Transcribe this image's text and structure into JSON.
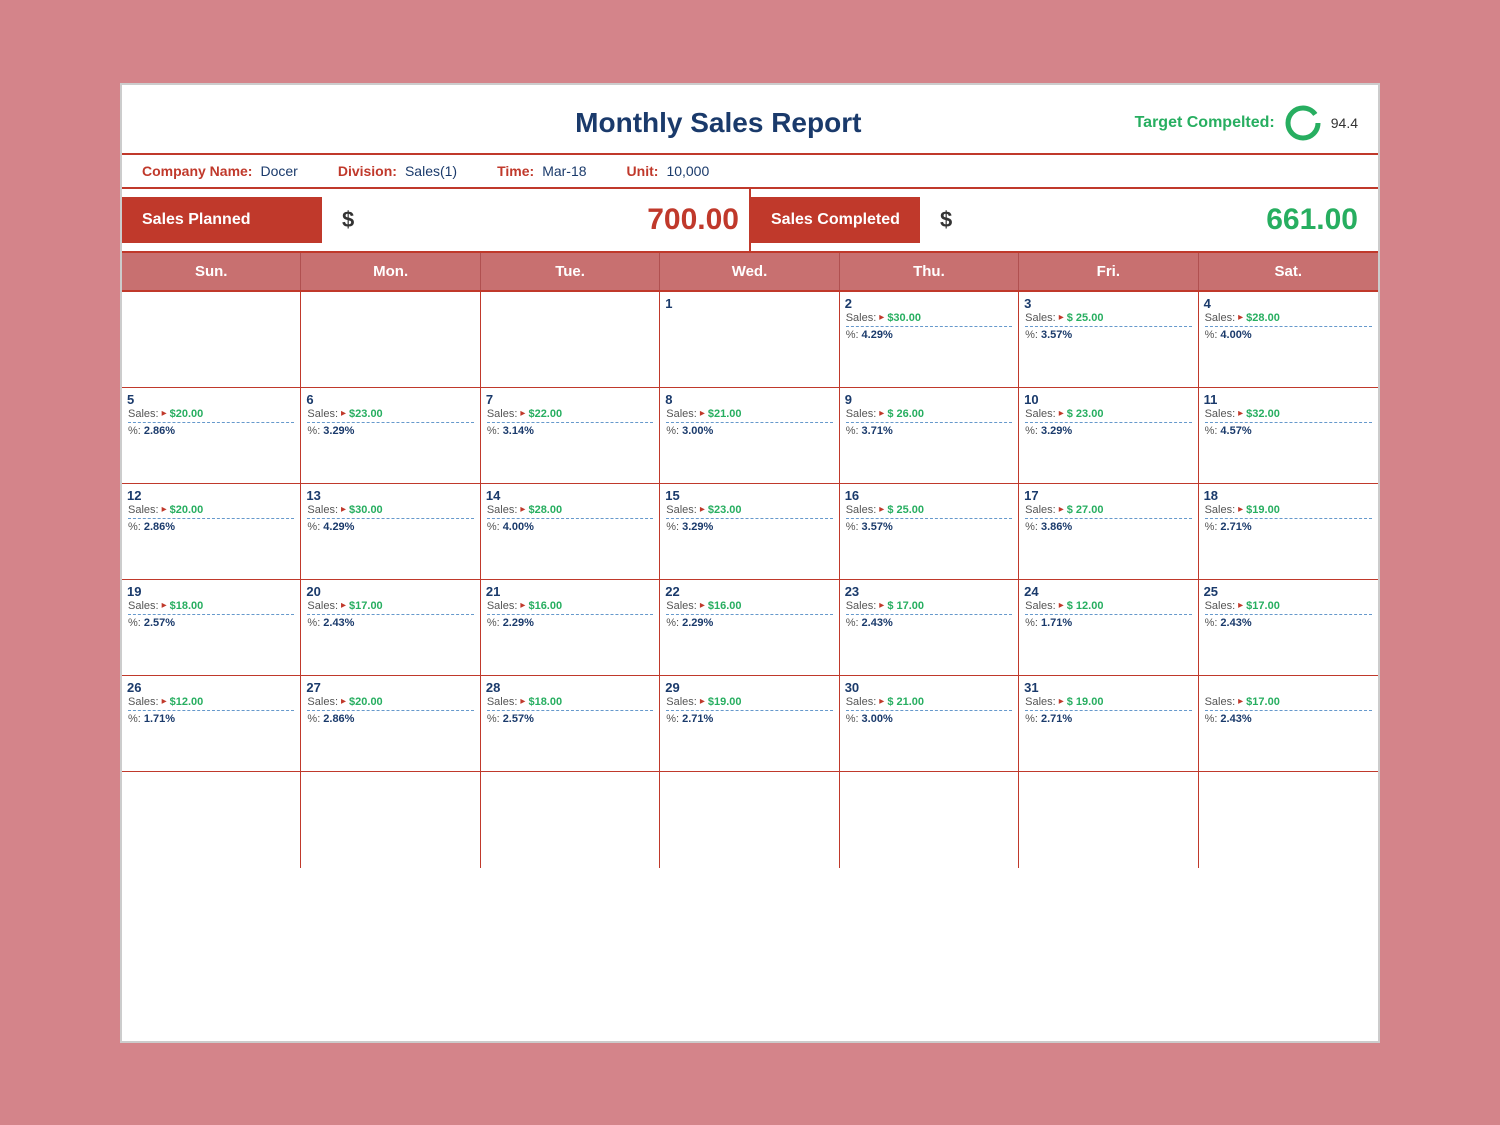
{
  "report": {
    "title": "Monthly Sales Report",
    "target_label": "Target Compelted:",
    "target_value": "94.4",
    "company_label": "Company Name:",
    "company_name": "Docer",
    "division_label": "Division:",
    "division_value": "Sales(1)",
    "time_label": "Time:",
    "time_value": "Mar-18",
    "unit_label": "Unit:",
    "unit_value": "10,000",
    "sales_planned_label": "Sales Planned",
    "sales_planned_dollar": "$",
    "sales_planned_amount": "700.00",
    "sales_completed_label": "Sales Completed",
    "sales_completed_dollar": "$",
    "sales_completed_amount": "661.00"
  },
  "day_headers": [
    "Sun.",
    "Mon.",
    "Tue.",
    "Wed.",
    "Thu.",
    "Fri.",
    "Sat."
  ],
  "weeks": [
    [
      {
        "day": "",
        "sales": "",
        "pct": ""
      },
      {
        "day": "",
        "sales": "",
        "pct": ""
      },
      {
        "day": "",
        "sales": "",
        "pct": ""
      },
      {
        "day": "1",
        "sales": "",
        "pct": ""
      },
      {
        "day": "2",
        "sales": "$30.00",
        "pct": "4.29%"
      },
      {
        "day": "3",
        "sales": "$ 25.00",
        "pct": "3.57%"
      },
      {
        "day": "4",
        "sales": "$28.00",
        "pct": "4.00%"
      }
    ],
    [
      {
        "day": "5",
        "sales": "$20.00",
        "pct": "2.86%"
      },
      {
        "day": "6",
        "sales": "$23.00",
        "pct": "3.29%"
      },
      {
        "day": "7",
        "sales": "$22.00",
        "pct": "3.14%"
      },
      {
        "day": "8",
        "sales": "$21.00",
        "pct": "3.00%"
      },
      {
        "day": "9",
        "sales": "$ 26.00",
        "pct": "3.71%"
      },
      {
        "day": "10",
        "sales": "$ 23.00",
        "pct": "3.29%"
      },
      {
        "day": "11",
        "sales": "$32.00",
        "pct": "4.57%"
      }
    ],
    [
      {
        "day": "12",
        "sales": "$20.00",
        "pct": "2.86%"
      },
      {
        "day": "13",
        "sales": "$30.00",
        "pct": "4.29%"
      },
      {
        "day": "14",
        "sales": "$28.00",
        "pct": "4.00%"
      },
      {
        "day": "15",
        "sales": "$23.00",
        "pct": "3.29%"
      },
      {
        "day": "16",
        "sales": "$ 25.00",
        "pct": "3.57%"
      },
      {
        "day": "17",
        "sales": "$ 27.00",
        "pct": "3.86%"
      },
      {
        "day": "18",
        "sales": "$19.00",
        "pct": "2.71%"
      }
    ],
    [
      {
        "day": "19",
        "sales": "$18.00",
        "pct": "2.57%"
      },
      {
        "day": "20",
        "sales": "$17.00",
        "pct": "2.43%"
      },
      {
        "day": "21",
        "sales": "$16.00",
        "pct": "2.29%"
      },
      {
        "day": "22",
        "sales": "$16.00",
        "pct": "2.29%"
      },
      {
        "day": "23",
        "sales": "$ 17.00",
        "pct": "2.43%"
      },
      {
        "day": "24",
        "sales": "$ 12.00",
        "pct": "1.71%"
      },
      {
        "day": "25",
        "sales": "$17.00",
        "pct": "2.43%"
      }
    ],
    [
      {
        "day": "26",
        "sales": "$12.00",
        "pct": "1.71%"
      },
      {
        "day": "27",
        "sales": "$20.00",
        "pct": "2.86%"
      },
      {
        "day": "28",
        "sales": "$18.00",
        "pct": "2.57%"
      },
      {
        "day": "29",
        "sales": "$19.00",
        "pct": "2.71%"
      },
      {
        "day": "30",
        "sales": "$ 21.00",
        "pct": "3.00%"
      },
      {
        "day": "31",
        "sales": "$ 19.00",
        "pct": "2.71%"
      },
      {
        "day": "",
        "sales": "$17.00",
        "pct": "2.43%"
      }
    ],
    [
      {
        "day": "",
        "sales": "",
        "pct": ""
      },
      {
        "day": "",
        "sales": "",
        "pct": ""
      },
      {
        "day": "",
        "sales": "",
        "pct": ""
      },
      {
        "day": "",
        "sales": "",
        "pct": ""
      },
      {
        "day": "",
        "sales": "",
        "pct": ""
      },
      {
        "day": "",
        "sales": "",
        "pct": ""
      },
      {
        "day": "",
        "sales": "",
        "pct": ""
      }
    ]
  ]
}
